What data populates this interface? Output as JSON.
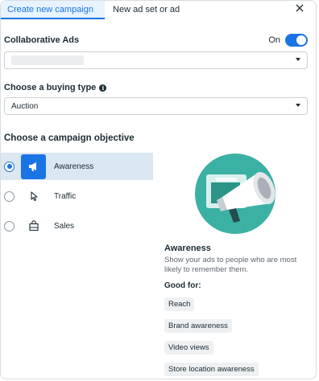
{
  "tabs": [
    {
      "label": "Create new campaign",
      "active": true
    },
    {
      "label": "New ad set or ad",
      "active": false
    }
  ],
  "collaborative": {
    "label": "Collaborative Ads",
    "toggle_label": "On",
    "toggle_on": true
  },
  "buying_type": {
    "label": "Choose a buying type",
    "value": "Auction"
  },
  "objective": {
    "heading": "Choose a campaign objective",
    "options": [
      {
        "label": "Awareness",
        "icon": "megaphone-icon",
        "selected": true
      },
      {
        "label": "Traffic",
        "icon": "cursor-icon",
        "selected": false
      },
      {
        "label": "Sales",
        "icon": "shopping-bag-icon",
        "selected": false
      }
    ]
  },
  "detail": {
    "title": "Awareness",
    "description": "Show your ads to people who are most likely to remember them.",
    "good_for_label": "Good for:",
    "chips": [
      "Reach",
      "Brand awareness",
      "Video views",
      "Store location awareness"
    ]
  },
  "colors": {
    "accent": "#1b74e4",
    "selected_bg": "#dbe7f2",
    "illustration_teal": "#3bb1a4"
  }
}
